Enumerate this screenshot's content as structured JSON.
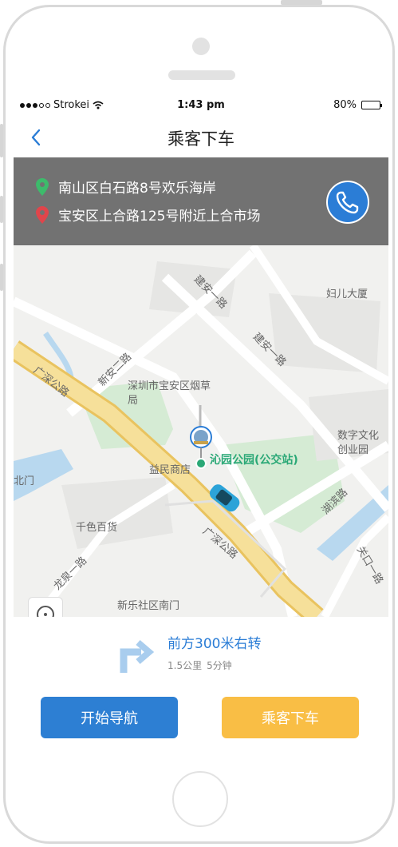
{
  "status_bar": {
    "carrier": "Strokei",
    "time": "1:43 pm",
    "battery": "80%"
  },
  "nav": {
    "title": "乘客下车",
    "back_icon": "chevron-left-icon"
  },
  "addresses": {
    "origin": "南山区白石路8号欢乐海岸",
    "destination": "宝安区上合路125号附近上合市场",
    "origin_color": "#3dbb6b",
    "destination_color": "#e0454b",
    "call_icon": "phone-icon"
  },
  "map": {
    "labels": {
      "jianan_yilu_1": "建安一路",
      "jianan_yilu_2": "建安一路",
      "fuer_dasha": "妇儿大厦",
      "xinan_erlu": "新安二路",
      "guangshen_1": "广深公路",
      "guangshen_2": "广深公路",
      "tobacco": "深圳市宝安区烟草局",
      "shuzi": "数字文化创业园",
      "yimin": "益民商店",
      "hubin": "湖滨路",
      "qianse": "千色百货",
      "longquan": "龙泉一路",
      "guankou": "关口一路",
      "xinle": "新乐社区南门",
      "gate_left": "北门"
    },
    "poi_label": "沁园公园(公交站)"
  },
  "navigation": {
    "instruction": "前方300米右转",
    "distance": "1.5公里",
    "duration": "5分钟",
    "turn_icon": "turn-right-arrow-icon"
  },
  "buttons": {
    "start_nav": "开始导航",
    "drop_off": "乘客下车"
  },
  "colors": {
    "accent_blue": "#2d7fd3",
    "accent_yellow": "#f9be45",
    "poi_green": "#2aa876",
    "panel_gray": "#727272"
  }
}
